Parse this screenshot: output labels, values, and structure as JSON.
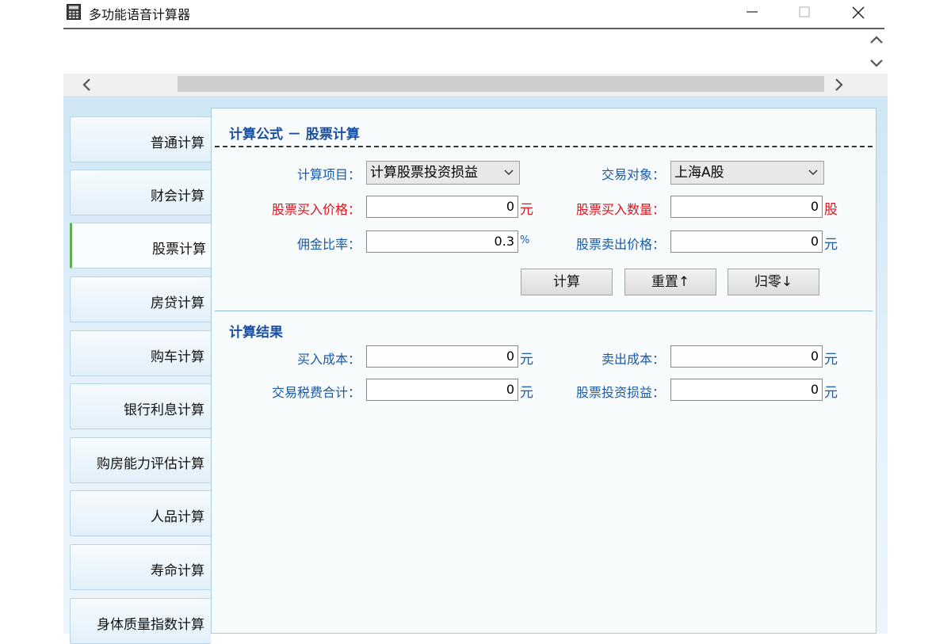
{
  "window": {
    "title": "多功能语音计算器",
    "minimize_glyph": "—",
    "close_glyph": "✕"
  },
  "sidebar": {
    "items": [
      {
        "label": "普通计算"
      },
      {
        "label": "财会计算"
      },
      {
        "label": "股票计算"
      },
      {
        "label": "房贷计算"
      },
      {
        "label": "购车计算"
      },
      {
        "label": "银行利息计算"
      },
      {
        "label": "购房能力评估计算"
      },
      {
        "label": "人品计算"
      },
      {
        "label": "寿命计算"
      },
      {
        "label": "身体质量指数计算"
      }
    ],
    "active_index": 2
  },
  "formula": {
    "title": "计算公式 － 股票计算",
    "project_label": "计算项目：",
    "project_value": "计算股票投资损益",
    "target_label": "交易对象：",
    "target_value": "上海A股",
    "buy_price_label": "股票买入价格：",
    "buy_price_value": "0",
    "buy_price_unit": "元",
    "buy_qty_label": "股票买入数量：",
    "buy_qty_value": "0",
    "buy_qty_unit": "股",
    "commission_label": "佣金比率：",
    "commission_value": "0.3",
    "commission_unit": "%",
    "sell_price_label": "股票卖出价格：",
    "sell_price_value": "0",
    "sell_price_unit": "元"
  },
  "buttons": {
    "calc": "计算",
    "reset": "重置↑",
    "zero": "归零↓"
  },
  "result": {
    "title": "计算结果",
    "buy_cost_label": "买入成本：",
    "buy_cost_value": "0",
    "buy_cost_unit": "元",
    "sell_cost_label": "卖出成本：",
    "sell_cost_value": "0",
    "sell_cost_unit": "元",
    "tax_label": "交易税费合计：",
    "tax_value": "0",
    "tax_unit": "元",
    "profit_label": "股票投资损益：",
    "profit_value": "0",
    "profit_unit": "元"
  },
  "colors": {
    "label_blue": "#1a5aa8",
    "label_red": "#e0141e",
    "title_blue": "#1a4f9e",
    "active_nav_accent": "#5fae52"
  }
}
